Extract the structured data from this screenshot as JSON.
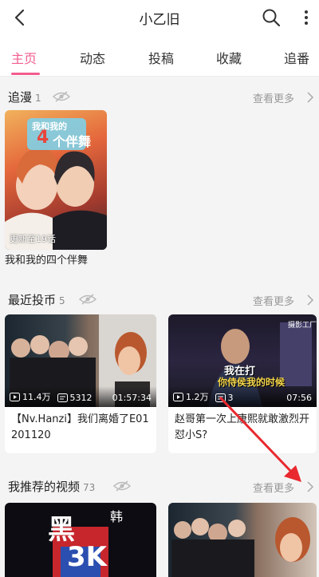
{
  "header": {
    "title": "小乙旧"
  },
  "tabs": [
    {
      "label": "主页",
      "active": true
    },
    {
      "label": "动态"
    },
    {
      "label": "投稿"
    },
    {
      "label": "收藏"
    },
    {
      "label": "追番"
    }
  ],
  "sections": {
    "following": {
      "title": "追漫",
      "count": "1",
      "more": "查看更多",
      "item": {
        "cover_title_top": "我和我的",
        "cover_title_num": "4",
        "cover_title_sub": "个伴舞",
        "badge": "更新至19话",
        "caption": "我和我的四个伴舞"
      }
    },
    "coins": {
      "title": "最近投币",
      "count": "5",
      "more": "查看更多",
      "videos": [
        {
          "views": "11.4万",
          "danmaku": "5312",
          "duration": "01:57:34",
          "title": "【Nv.Hanzi】我们离婚了E01 201120"
        },
        {
          "views": "1.2万",
          "danmaku": "3",
          "duration": "07:56",
          "title": "赵哥第一次上康熙就敢激烈开怼小S?",
          "thumb_overlay_1": "我在打",
          "thumb_overlay_2": "你侍侯我的时候",
          "thumb_corner": "摄影工厂"
        }
      ]
    },
    "recommended": {
      "title": "我推荐的视频",
      "count": "73",
      "more": "查看更多",
      "videos": [
        {
          "thumb_text_1": "黑",
          "thumb_text_2": "韩",
          "thumb_text_3": "3K"
        },
        {}
      ]
    }
  },
  "colors": {
    "accent": "#f25d8e",
    "arrow": "#e8292f"
  }
}
